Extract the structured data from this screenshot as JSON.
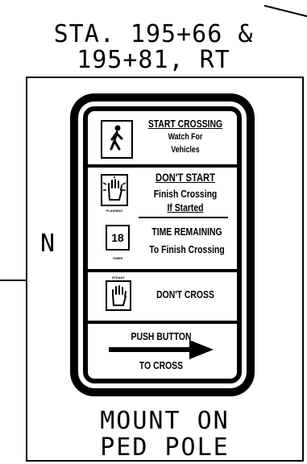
{
  "station": {
    "line1": "STA. 195+66 &",
    "line2": "195+81, RT"
  },
  "orientation": "N",
  "mount_note": {
    "line1": "MOUNT ON",
    "line2": "PED POLE"
  },
  "sign": {
    "start_title": "START CROSSING",
    "start_sub1": "Watch For",
    "start_sub2": "Vehicles",
    "dont_start_title": "DON'T START",
    "dont_start_sub1": "Finish Crossing",
    "dont_start_sub2": "If Started",
    "flashing_label": "FLASHING",
    "countdown_value": "18",
    "timer_label": "TIMER",
    "time_title": "TIME REMAINING",
    "time_sub": "To Finish Crossing",
    "steady_label": "STEADY",
    "dont_cross": "DON'T CROSS",
    "push_line1": "PUSH BUTTON",
    "push_line2": "TO CROSS"
  }
}
